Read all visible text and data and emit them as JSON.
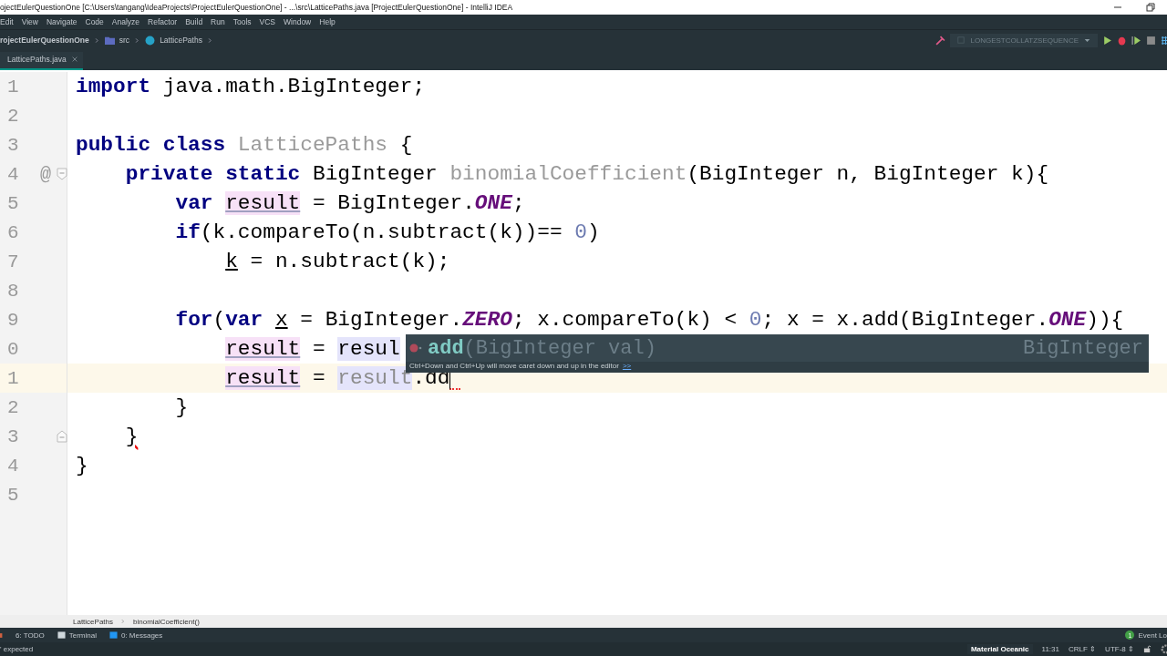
{
  "window": {
    "title": "ojectEulerQuestionOne [C:\\Users\\tangang\\IdeaProjects\\ProjectEulerQuestionOne] - ...\\src\\LatticePaths.java [ProjectEulerQuestionOne] - IntelliJ IDEA"
  },
  "menu": [
    "Edit",
    "View",
    "Navigate",
    "Code",
    "Analyze",
    "Refactor",
    "Build",
    "Run",
    "Tools",
    "VCS",
    "Window",
    "Help"
  ],
  "navbar": {
    "project": "rojectEulerQuestionOne",
    "folder": "src",
    "class": "LatticePaths"
  },
  "run_config": "LONGESTCOLLATZSEQUENCE",
  "tabs": [
    {
      "label": "LatticePaths.java",
      "selected": true
    }
  ],
  "editor": {
    "lines": [
      {
        "number": "1",
        "tokens": [
          {
            "kind": "kw",
            "t": "import"
          },
          {
            "kind": "plain",
            "t": " java.math.BigInteger;"
          }
        ]
      },
      {
        "number": "2"
      },
      {
        "number": "3",
        "tokens": [
          {
            "kind": "kw",
            "t": "public class "
          },
          {
            "kind": "unused",
            "t": "LatticePaths"
          },
          {
            "kind": "plain",
            "t": " {"
          }
        ]
      },
      {
        "number": "4",
        "gutter_mark": "@",
        "fold": {
          "kind": "start"
        },
        "tokens": [
          {
            "kind": "kw",
            "t": "    private static"
          },
          {
            "kind": "plain",
            "t": " BigInteger "
          },
          {
            "kind": "unused",
            "t": "binomialCoefficient"
          },
          {
            "kind": "plain",
            "t": "(BigInteger n, BigInteger k){"
          }
        ]
      },
      {
        "number": "5",
        "tokens": [
          {
            "kind": "kw",
            "t": "        var "
          },
          {
            "kind": "write",
            "t": "result"
          },
          {
            "kind": "plain",
            "t": " = BigInteger."
          },
          {
            "kind": "const",
            "t": "ONE"
          },
          {
            "kind": "plain",
            "t": ";"
          }
        ]
      },
      {
        "number": "6",
        "tokens": [
          {
            "kind": "kw",
            "t": "        if"
          },
          {
            "kind": "plain",
            "t": "(k.compareTo(n.subtract(k))== "
          },
          {
            "kind": "num",
            "t": "0"
          },
          {
            "kind": "plain",
            "t": ")"
          }
        ]
      },
      {
        "number": "7",
        "tokens": [
          {
            "kind": "param",
            "t": "            k"
          },
          {
            "kind": "plain",
            "t": " = n.subtract(k);"
          }
        ]
      },
      {
        "number": "8"
      },
      {
        "number": "9",
        "tokens": [
          {
            "kind": "kw",
            "t": "        for"
          },
          {
            "kind": "plain",
            "t": "("
          },
          {
            "kind": "kw",
            "t": "var "
          },
          {
            "kind": "param",
            "t": "x"
          },
          {
            "kind": "plain",
            "t": " = BigInteger."
          },
          {
            "kind": "const",
            "t": "ZERO"
          },
          {
            "kind": "plain",
            "t": "; x.compareTo(k) < "
          },
          {
            "kind": "num",
            "t": "0"
          },
          {
            "kind": "plain",
            "t": "; x = x.add(BigInteger."
          },
          {
            "kind": "const",
            "t": "ONE"
          },
          {
            "kind": "plain",
            "t": ")){"
          }
        ]
      },
      {
        "number": "0",
        "tokens": [
          {
            "kind": "write",
            "t": "            result"
          },
          {
            "kind": "plain",
            "t": " = "
          },
          {
            "kind": "read",
            "t": "resul"
          }
        ]
      },
      {
        "number": "1",
        "current": true,
        "tokens": [
          {
            "kind": "write",
            "t": "            result"
          },
          {
            "kind": "plain",
            "t": " = "
          },
          {
            "kind": "read_muted",
            "t": "result"
          },
          {
            "kind": "plain",
            "t": ".dd"
          }
        ]
      },
      {
        "number": "2",
        "tokens": [
          {
            "kind": "plain",
            "t": "        }"
          }
        ]
      },
      {
        "number": "3",
        "fold": {
          "kind": "end"
        },
        "tokens": [
          {
            "kind": "error",
            "t": "    }"
          }
        ]
      },
      {
        "number": "4",
        "tokens": [
          {
            "kind": "plain",
            "t": "}"
          }
        ]
      },
      {
        "number": "5"
      }
    ]
  },
  "completion": {
    "method": "add",
    "params": "(BigInteger val)",
    "return_type": "BigInteger",
    "hint": "Ctrl+Down and Ctrl+Up will move caret down and up in the editor",
    "hint_link": ">>"
  },
  "breadcrumbs": [
    "LatticePaths",
    "binomialCoefficient()"
  ],
  "tool_tabs": [
    "6: TODO",
    "Terminal",
    "0: Messages"
  ],
  "event_log": {
    "count": "1",
    "label": "Event Lo"
  },
  "status": {
    "message": "' expected",
    "theme": "Material Oceanic",
    "position": "11:31",
    "line_sep": "CRLF ⇕",
    "encoding": "UTF-8 ⇕"
  }
}
